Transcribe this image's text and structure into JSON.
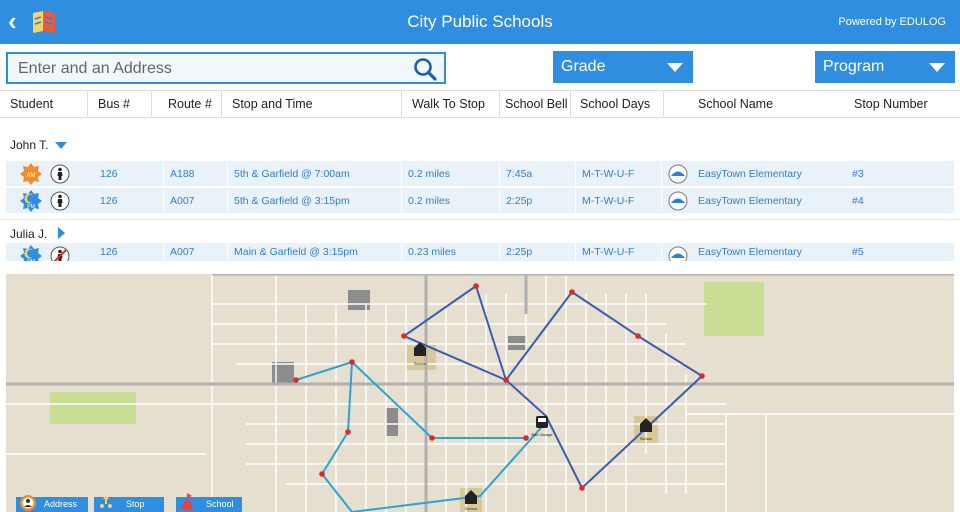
{
  "app": {
    "title": "City Public Schools",
    "powered_by": "Powered by EDULOG",
    "back_glyph": "‹"
  },
  "search": {
    "placeholder": "Enter and an Address",
    "value": ""
  },
  "filters": {
    "grade_label": "Grade",
    "program_label": "Program"
  },
  "table": {
    "headers": [
      "Student",
      "Bus #",
      "Route #",
      "Stop and Time",
      "Walk To Stop",
      "School Bell",
      "School Days",
      "School Name",
      "Stop Number"
    ],
    "groups": [
      {
        "student": "John T.",
        "expanded": true,
        "rows": [
          {
            "period": "AM",
            "bus": "126",
            "route": "A188",
            "stop_time": "5th & Garfield @ 7:00am",
            "walk": "0.2 miles",
            "bell": "7:45a",
            "days": "M-T-W-U-F",
            "school": "EasyTown Elementary",
            "stop_number": "#3",
            "walk_icon": "walking-person-icon"
          },
          {
            "period": "PM",
            "bus": "126",
            "route": "A007",
            "stop_time": "5th & Garfield @ 3:15pm",
            "walk": "0.2 miles",
            "bell": "2:25p",
            "days": "M-T-W-U-F",
            "school": "EasyTown Elementary",
            "stop_number": "#4",
            "walk_icon": "walking-person-icon"
          }
        ]
      },
      {
        "student": "Julia J.",
        "expanded": false,
        "rows": [
          {
            "period": "PM",
            "bus": "126",
            "route": "A007",
            "stop_time": "Main & Garfield @ 3:15pm",
            "walk": "0.23 miles",
            "bell": "2:25p",
            "days": "M-T-W-U-F",
            "school": "EasyTown Elementary",
            "stop_number": "#5",
            "walk_icon": "no-walking-icon"
          }
        ]
      }
    ]
  },
  "map": {
    "school_label": "School",
    "bus_label": "Bus Garage",
    "route_colors": {
      "dark": "#3a5cb0",
      "light": "#2ba3d3"
    },
    "stop_color": "#d92b2b"
  },
  "legend": {
    "address": "Address",
    "stop": "Stop",
    "school": "School"
  },
  "colors": {
    "brand": "#2f8ee0",
    "row_bg": "#e9f1f9",
    "am_orange": "#f28c28",
    "pm_blue": "#2f8ee0",
    "map_bg": "#e6dfcf",
    "park": "#c9dd94"
  }
}
